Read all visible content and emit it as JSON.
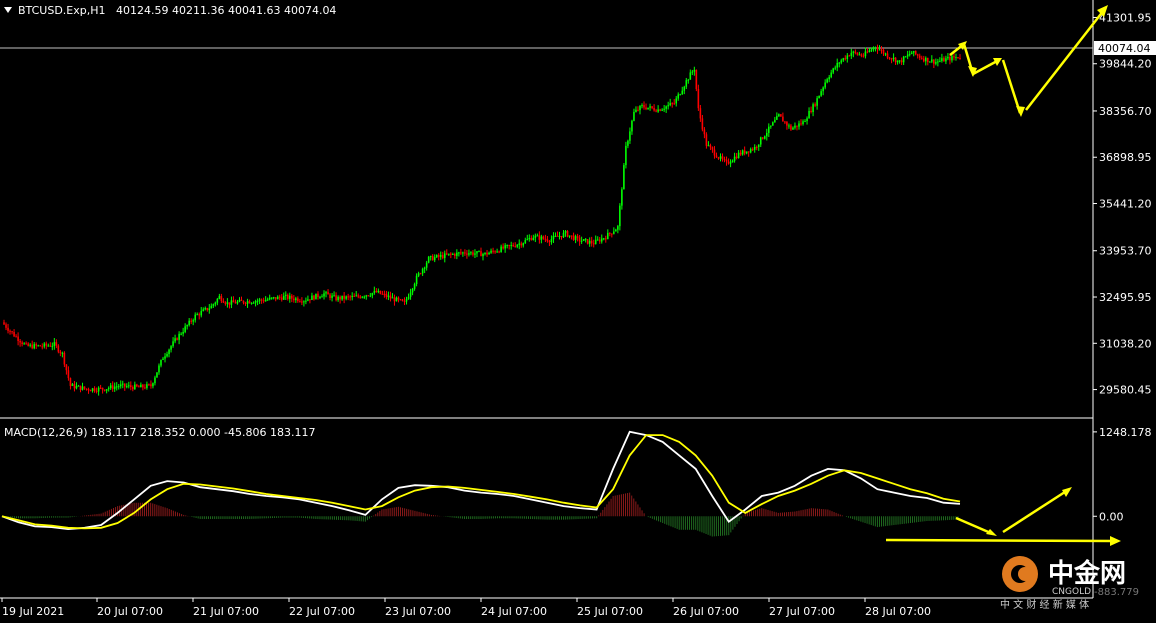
{
  "colors": {
    "background": "#000000",
    "bull": "#00ff00",
    "bear": "#ff0000",
    "grid_border": "#ffffff",
    "macd_line": "#ffffff",
    "signal_line": "#ffff00",
    "hist_pos": "#8b1a1a",
    "hist_neg": "#1f6b1f",
    "arrow": "#ffff00",
    "price_tag_bg": "#ffffff",
    "watermark_brand": "#e07a1f"
  },
  "header": {
    "symbol": "BTCUSD.Exp,H1",
    "ohlc": "40124.59 40211.36 40041.63 40074.04"
  },
  "macd_header": "MACD(12,26,9) 183.117 218.352 0.000 -45.806 183.117",
  "current_price_label": "40074.04",
  "watermark": {
    "brand": "中金网",
    "sub": "CNGOLD",
    "tagline": "中 文 财 经 新 媒 体",
    "partial_value": "-883.779"
  },
  "chart_data": [
    {
      "type": "candlestick",
      "title": "BTCUSD.Exp,H1",
      "ylim": [
        29000,
        41600
      ],
      "price_ticks": [
        "41301.95",
        "39844.20",
        "38356.70",
        "36898.95",
        "35441.20",
        "33953.70",
        "32495.95",
        "31038.20",
        "29580.45"
      ],
      "price_tick_values": [
        41301.95,
        39844.2,
        38356.7,
        36898.95,
        35441.2,
        33953.7,
        32495.95,
        31038.2,
        29580.45
      ],
      "current_price": 40074.04,
      "x_labels": [
        "19 Jul 2021",
        "20 Jul 07:00",
        "21 Jul 07:00",
        "22 Jul 07:00",
        "23 Jul 07:00",
        "24 Jul 07:00",
        "25 Jul 07:00",
        "26 Jul 07:00",
        "27 Jul 07:00",
        "28 Jul 07:00"
      ],
      "close_path_points": [
        [
          0,
          31700
        ],
        [
          6,
          31300
        ],
        [
          12,
          30950
        ],
        [
          20,
          30950
        ],
        [
          26,
          31000
        ],
        [
          30,
          30700
        ],
        [
          34,
          29700
        ],
        [
          42,
          29600
        ],
        [
          50,
          29600
        ],
        [
          58,
          29700
        ],
        [
          68,
          29650
        ],
        [
          74,
          29700
        ],
        [
          80,
          30600
        ],
        [
          88,
          31300
        ],
        [
          96,
          31900
        ],
        [
          104,
          32200
        ],
        [
          108,
          32500
        ],
        [
          112,
          32300
        ],
        [
          120,
          32350
        ],
        [
          130,
          32400
        ],
        [
          140,
          32500
        ],
        [
          150,
          32400
        ],
        [
          160,
          32600
        ],
        [
          166,
          32450
        ],
        [
          176,
          32500
        ],
        [
          186,
          32650
        ],
        [
          194,
          32450
        ],
        [
          200,
          32300
        ],
        [
          206,
          33100
        ],
        [
          212,
          33700
        ],
        [
          220,
          33800
        ],
        [
          230,
          33900
        ],
        [
          240,
          33850
        ],
        [
          250,
          34050
        ],
        [
          258,
          34200
        ],
        [
          264,
          34400
        ],
        [
          272,
          34300
        ],
        [
          280,
          34500
        ],
        [
          286,
          34300
        ],
        [
          294,
          34200
        ],
        [
          300,
          34400
        ],
        [
          306,
          34700
        ],
        [
          310,
          37200
        ],
        [
          314,
          38300
        ],
        [
          318,
          38500
        ],
        [
          326,
          38400
        ],
        [
          334,
          38600
        ],
        [
          340,
          39300
        ],
        [
          344,
          39700
        ],
        [
          346,
          38400
        ],
        [
          350,
          37300
        ],
        [
          356,
          36900
        ],
        [
          360,
          36700
        ],
        [
          366,
          37000
        ],
        [
          374,
          37200
        ],
        [
          380,
          37700
        ],
        [
          386,
          38200
        ],
        [
          392,
          37800
        ],
        [
          398,
          38000
        ],
        [
          404,
          38600
        ],
        [
          410,
          39400
        ],
        [
          416,
          39900
        ],
        [
          422,
          40200
        ],
        [
          428,
          40100
        ],
        [
          434,
          40400
        ],
        [
          440,
          40100
        ],
        [
          446,
          39900
        ],
        [
          452,
          40200
        ],
        [
          458,
          40000
        ],
        [
          464,
          39900
        ],
        [
          470,
          40000
        ],
        [
          476,
          40074
        ]
      ],
      "forecast_arrow_text": ""
    },
    {
      "type": "line",
      "title": "MACD(12,26,9)",
      "ylim": [
        -1150,
        1350
      ],
      "y_ticks": [
        "1248.178",
        "0.00"
      ],
      "y_tick_values": [
        1248.178,
        0
      ],
      "series": [
        {
          "name": "MACD",
          "values": [
            0,
            -90,
            -150,
            -160,
            -190,
            -170,
            -130,
            50,
            250,
            450,
            520,
            500,
            430,
            400,
            370,
            330,
            300,
            280,
            250,
            200,
            150,
            90,
            20,
            250,
            420,
            460,
            450,
            430,
            380,
            350,
            330,
            300,
            250,
            200,
            150,
            120,
            100,
            700,
            1250,
            1200,
            1100,
            900,
            700,
            300,
            -80,
            100,
            300,
            350,
            450,
            600,
            700,
            680,
            560,
            400,
            350,
            300,
            270,
            200,
            183
          ]
        },
        {
          "name": "Signal",
          "values": [
            0,
            -60,
            -120,
            -140,
            -170,
            -180,
            -170,
            -100,
            50,
            250,
            400,
            480,
            470,
            440,
            410,
            370,
            330,
            300,
            270,
            240,
            200,
            150,
            100,
            150,
            280,
            380,
            430,
            440,
            420,
            390,
            360,
            330,
            290,
            250,
            200,
            160,
            130,
            400,
            900,
            1200,
            1200,
            1100,
            900,
            600,
            200,
            50,
            180,
            300,
            380,
            480,
            600,
            680,
            640,
            560,
            480,
            400,
            340,
            260,
            218
          ]
        },
        {
          "name": "Histogram",
          "values": [
            0,
            -30,
            -30,
            -20,
            -20,
            10,
            40,
            150,
            200,
            200,
            120,
            20,
            -40,
            -40,
            -40,
            -40,
            -30,
            -20,
            -20,
            -40,
            -50,
            -60,
            -80,
            100,
            140,
            80,
            20,
            -10,
            -40,
            -40,
            -30,
            -30,
            -40,
            -50,
            -50,
            -40,
            -30,
            300,
            350,
            0,
            -100,
            -200,
            -200,
            -300,
            -280,
            50,
            120,
            50,
            70,
            120,
            100,
            0,
            -80,
            -160,
            -130,
            -100,
            -70,
            -60,
            -46
          ]
        }
      ]
    }
  ]
}
